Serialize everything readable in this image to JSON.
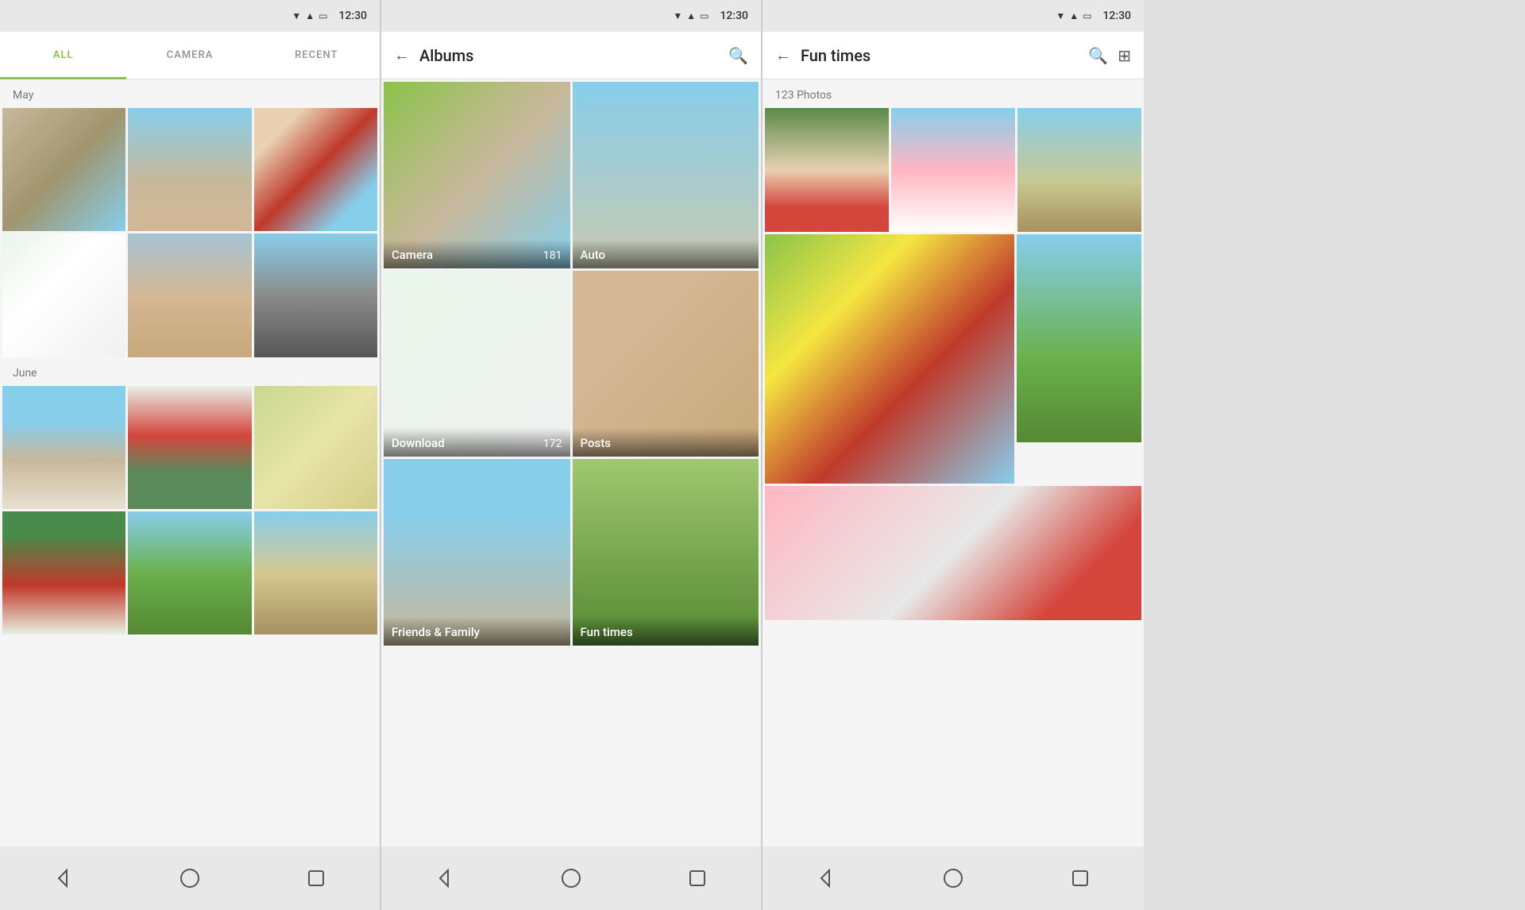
{
  "screen1": {
    "status": {
      "time": "12:30"
    },
    "tabs": [
      {
        "id": "all",
        "label": "ALL",
        "active": true
      },
      {
        "id": "camera",
        "label": "CAMERA",
        "active": false
      },
      {
        "id": "recent",
        "label": "RECENT",
        "active": false
      }
    ],
    "sections": [
      {
        "label": "May",
        "photos": [
          "beach-path",
          "beach-wave",
          "mother-child",
          "flowers-white",
          "dog-sitting",
          "street-view"
        ]
      },
      {
        "label": "June",
        "photos": [
          "beach-child",
          "boy-red",
          "plant-yellow",
          "cherries",
          "trees",
          "reeds"
        ]
      }
    ],
    "nav": [
      "back",
      "home",
      "square"
    ]
  },
  "screen2": {
    "status": {
      "time": "12:30"
    },
    "title": "Albums",
    "back_label": "←",
    "search_label": "🔍",
    "albums": [
      {
        "id": "camera",
        "name": "Camera",
        "count": "181"
      },
      {
        "id": "auto",
        "name": "Auto",
        "count": ""
      },
      {
        "id": "download",
        "name": "Download",
        "count": "172"
      },
      {
        "id": "posts",
        "name": "Posts",
        "count": ""
      },
      {
        "id": "friends-family",
        "name": "Friends & Family",
        "count": ""
      },
      {
        "id": "fun-times",
        "name": "Fun times",
        "count": ""
      }
    ],
    "nav": [
      "back",
      "home",
      "square"
    ]
  },
  "screen3": {
    "status": {
      "time": "12:30"
    },
    "title": "Fun times",
    "back_label": "←",
    "search_label": "🔍",
    "grid_label": "⊞",
    "photos_count": "123 Photos",
    "photos": [
      "family-park",
      "blossom",
      "reeds2",
      "food",
      "lake",
      "blossom2"
    ],
    "nav": [
      "back",
      "home",
      "square"
    ]
  }
}
